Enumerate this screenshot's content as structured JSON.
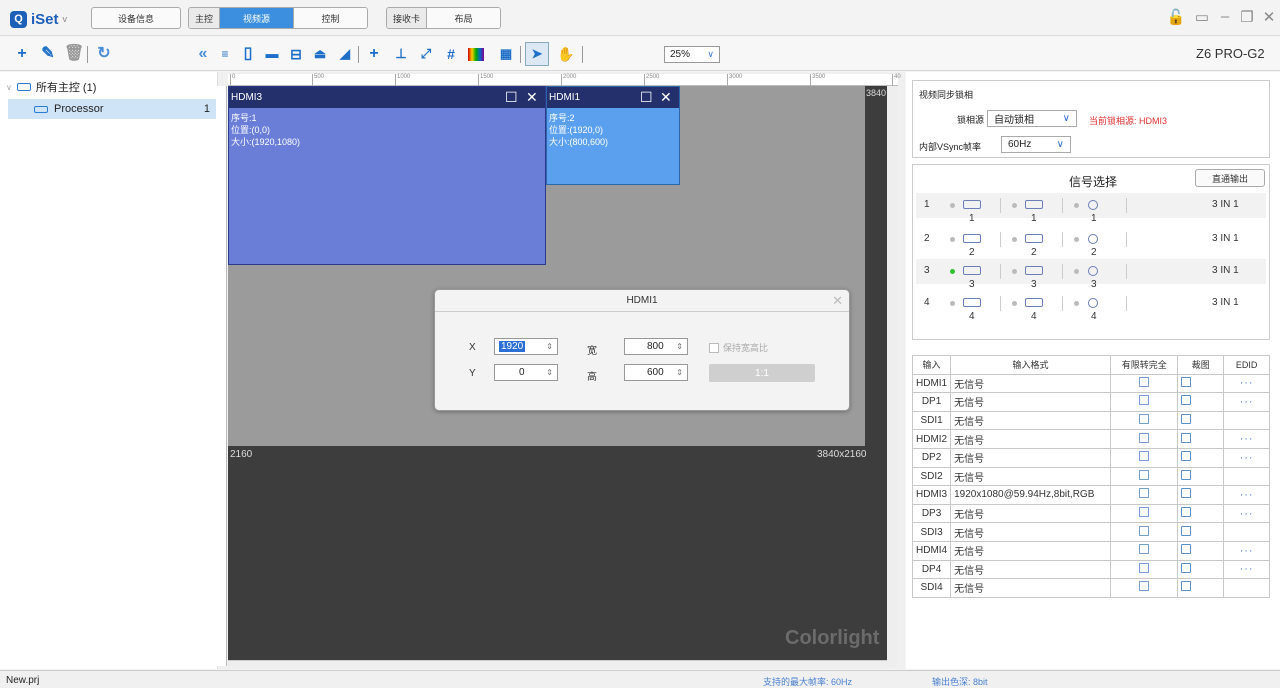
{
  "app": {
    "logo_glyph": "Q",
    "name": "iSet",
    "logo_dropdown": "v"
  },
  "topbar": {
    "device_info": "设备信息",
    "group_main": {
      "label": "主控",
      "tabs": [
        "视频源",
        "控制"
      ]
    },
    "group_recv": {
      "label": "接收卡",
      "tabs": [
        "布局"
      ]
    },
    "window_controls": [
      "lock-icon",
      "monitor-icon",
      "minimize-icon",
      "restore-icon",
      "close-icon"
    ]
  },
  "toolbar": {
    "collapse": "«",
    "zoom": "25%",
    "model": "Z6 PRO-G2",
    "icons": [
      "add-icon",
      "edit-icon",
      "delete-icon",
      "refresh-icon",
      "menu-icon",
      "new-file-icon",
      "open-folder-icon",
      "save-icon",
      "upload-icon",
      "download-icon",
      "add-window-icon",
      "insert-icon",
      "fit-icon",
      "grid-icon",
      "color-bar-icon",
      "layout-icon",
      "pointer-icon",
      "hand-icon"
    ]
  },
  "tree": {
    "root": "所有主控 (1)",
    "child": "Processor",
    "child_count": "1"
  },
  "canvas": {
    "ruler_ticks": [
      "0",
      "500",
      "1000",
      "1500",
      "2000",
      "2500",
      "3000",
      "3500",
      "40"
    ],
    "right_edge": "3840",
    "bottom_edge": "2160",
    "resolution": "3840x2160",
    "watermark": "Colorlight",
    "windows": [
      {
        "title": "HDMI3",
        "seq": "序号:1",
        "pos": "位置:(0,0)",
        "size": "大小:(1920,1080)"
      },
      {
        "title": "HDMI1",
        "seq": "序号:2",
        "pos": "位置:(1920,0)",
        "size": "大小:(800,600)"
      }
    ]
  },
  "dialog": {
    "title": "HDMI1",
    "x_label": "X",
    "x_value": "1920",
    "y_label": "Y",
    "y_value": "0",
    "w_label": "宽",
    "w_value": "800",
    "h_label": "高",
    "h_value": "600",
    "keep_ratio": "保持宽高比",
    "ratio_button": "1:1"
  },
  "sync": {
    "title": "视频同步锁相",
    "source_label": "锁相源",
    "source_value": "自动锁相",
    "current_label": "当前锁相源: HDMI3",
    "vsync_label": "内部VSync帧率",
    "vsync_value": "60Hz",
    "current_color": "#e03030"
  },
  "signal": {
    "title": "信号选择",
    "direct_btn": "直通输出",
    "rows": [
      {
        "num": "1",
        "active": false,
        "labels": [
          "1",
          "1",
          "1"
        ],
        "mode": "3 IN 1"
      },
      {
        "num": "2",
        "active": false,
        "labels": [
          "2",
          "2",
          "2"
        ],
        "mode": "3 IN 1"
      },
      {
        "num": "3",
        "active": true,
        "labels": [
          "3",
          "3",
          "3"
        ],
        "mode": "3 IN 1"
      },
      {
        "num": "4",
        "active": false,
        "labels": [
          "4",
          "4",
          "4"
        ],
        "mode": "3 IN 1"
      }
    ]
  },
  "inputs": {
    "headers": [
      "输入",
      "输入格式",
      "有限转完全",
      "裁图",
      "EDID"
    ],
    "rows": [
      {
        "name": "HDMI1",
        "format": "无信号",
        "edid": true
      },
      {
        "name": "DP1",
        "format": "无信号",
        "edid": true
      },
      {
        "name": "SDI1",
        "format": "无信号",
        "edid": false
      },
      {
        "name": "HDMI2",
        "format": "无信号",
        "edid": true
      },
      {
        "name": "DP2",
        "format": "无信号",
        "edid": true
      },
      {
        "name": "SDI2",
        "format": "无信号",
        "edid": false
      },
      {
        "name": "HDMI3",
        "format": "1920x1080@59.94Hz,8bit,RGB",
        "edid": true
      },
      {
        "name": "DP3",
        "format": "无信号",
        "edid": true
      },
      {
        "name": "SDI3",
        "format": "无信号",
        "edid": false
      },
      {
        "name": "HDMI4",
        "format": "无信号",
        "edid": true
      },
      {
        "name": "DP4",
        "format": "无信号",
        "edid": true
      },
      {
        "name": "SDI4",
        "format": "无信号",
        "edid": false
      }
    ],
    "edid_glyph": "···"
  },
  "status": {
    "project": "New.prj",
    "max_fps": "支持的最大帧率: 60Hz",
    "color_depth": "输出色深: 8bit"
  }
}
